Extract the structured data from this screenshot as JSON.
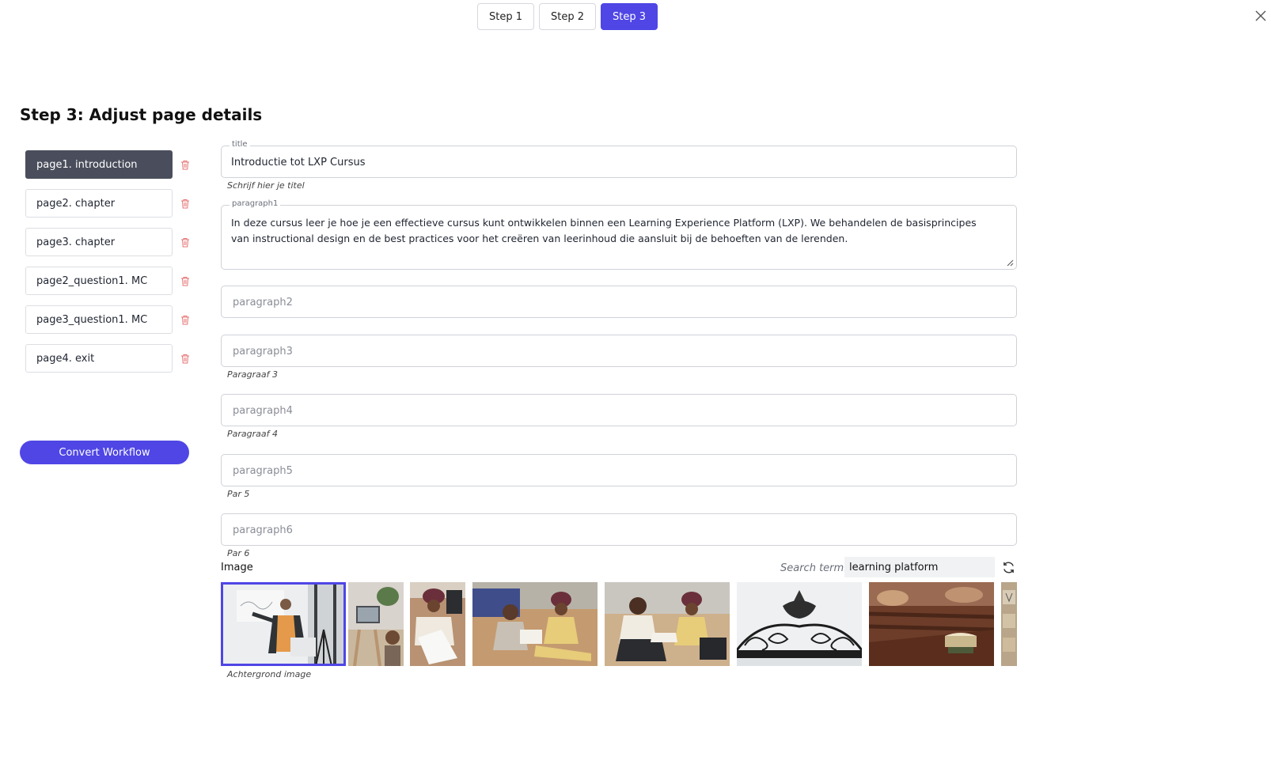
{
  "stepper": {
    "steps": [
      {
        "label": "Step 1",
        "active": false
      },
      {
        "label": "Step 2",
        "active": false
      },
      {
        "label": "Step 3",
        "active": true
      }
    ]
  },
  "heading": "Step 3: Adjust page details",
  "sidebar": {
    "pages": [
      {
        "label": "page1. introduction",
        "active": true
      },
      {
        "label": "page2. chapter",
        "active": false
      },
      {
        "label": "page3. chapter",
        "active": false
      },
      {
        "label": "page2_question1. MC",
        "active": false
      },
      {
        "label": "page3_question1. MC",
        "active": false
      },
      {
        "label": "page4. exit",
        "active": false
      }
    ],
    "convert_label": "Convert Workflow"
  },
  "form": {
    "title": {
      "label": "title",
      "value": "Introductie tot LXP Cursus",
      "helper": "Schrijf hier je titel"
    },
    "paragraph1": {
      "label": "paragraph1",
      "value": "In deze cursus leer je hoe je een effectieve cursus kunt ontwikkelen binnen een Learning Experience Platform (LXP). We behandelen de basisprincipes van instructional design en de best practices voor het creëren van leerinhoud die aansluit bij de behoeften van de lerenden."
    },
    "paragraph2": {
      "placeholder": "paragraph2"
    },
    "paragraph3": {
      "placeholder": "paragraph3",
      "helper": "Paragraaf 3"
    },
    "paragraph4": {
      "placeholder": "paragraph4",
      "helper": "Paragraaf 4"
    },
    "paragraph5": {
      "placeholder": "paragraph5",
      "helper": "Par 5"
    },
    "paragraph6": {
      "placeholder": "paragraph6",
      "helper": "Par 6"
    }
  },
  "image_section": {
    "label": "Image",
    "search_label": "Search term:",
    "search_value": "learning platform",
    "helper": "Achtergrond image",
    "selected_index": 0
  },
  "colors": {
    "accent": "#4f46e5",
    "active_page": "#4a4e5c",
    "danger": "#e05a5a"
  }
}
